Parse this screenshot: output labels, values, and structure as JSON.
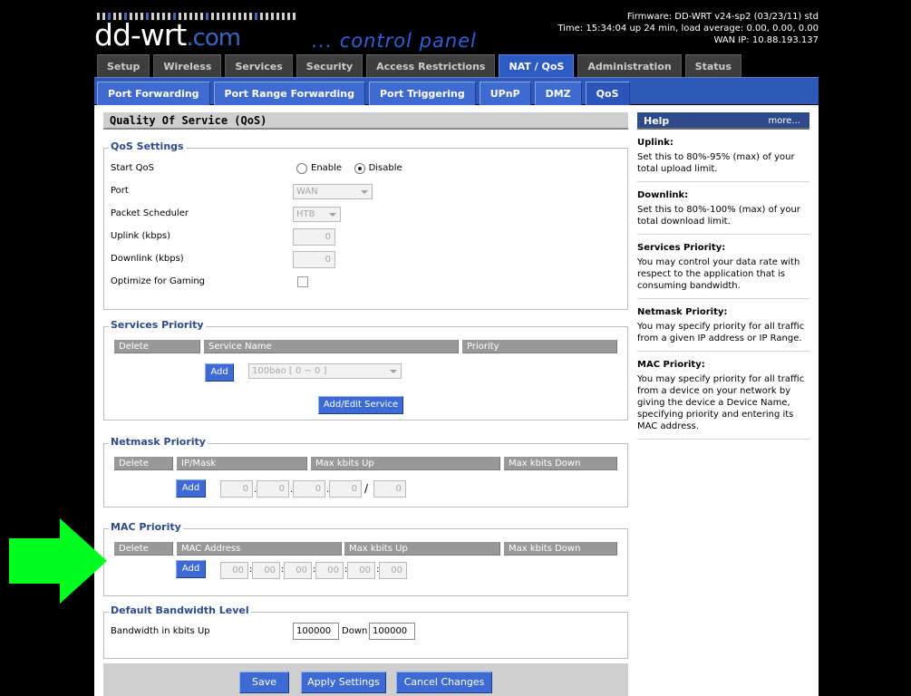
{
  "logo": {
    "main": "dd-wrt",
    "suffix": ".com",
    "tagline": "... control panel"
  },
  "firmware_info": {
    "firmware": "Firmware: DD-WRT v24-sp2 (03/23/11) std",
    "time": "Time: 15:34:04 up 24 min, load average: 0.00, 0.00, 0.00",
    "wan_ip": "WAN IP: 10.88.193.137"
  },
  "main_tabs": [
    {
      "label": "Setup"
    },
    {
      "label": "Wireless"
    },
    {
      "label": "Services"
    },
    {
      "label": "Security"
    },
    {
      "label": "Access Restrictions"
    },
    {
      "label": "NAT / QoS",
      "active": true
    },
    {
      "label": "Administration"
    },
    {
      "label": "Status"
    }
  ],
  "sub_tabs": [
    {
      "label": "Port Forwarding"
    },
    {
      "label": "Port Range Forwarding"
    },
    {
      "label": "Port Triggering"
    },
    {
      "label": "UPnP"
    },
    {
      "label": "DMZ"
    },
    {
      "label": "QoS",
      "active": true
    }
  ],
  "page_title": "Quality Of Service (QoS)",
  "qos_settings": {
    "legend": "QoS Settings",
    "start_qos_label": "Start QoS",
    "enable_label": "Enable",
    "disable_label": "Disable",
    "start_qos_value": "Disable",
    "port_label": "Port",
    "port_value": "WAN",
    "scheduler_label": "Packet Scheduler",
    "scheduler_value": "HTB",
    "uplink_label": "Uplink (kbps)",
    "uplink_value": "0",
    "downlink_label": "Downlink (kbps)",
    "downlink_value": "0",
    "gaming_label": "Optimize for Gaming"
  },
  "services_priority": {
    "legend": "Services Priority",
    "headers": [
      "Delete",
      "Service Name",
      "Priority"
    ],
    "add_label": "Add",
    "service_select": "100bao [ 0 ~ 0 ]",
    "add_edit_label": "Add/Edit Service"
  },
  "netmask_priority": {
    "legend": "Netmask Priority",
    "headers": [
      "Delete",
      "IP/Mask",
      "Max kbits Up",
      "Max kbits Down"
    ],
    "add_label": "Add",
    "ip_octets": [
      "0",
      "0",
      "0",
      "0"
    ],
    "mask": "0"
  },
  "mac_priority": {
    "legend": "MAC Priority",
    "headers": [
      "Delete",
      "MAC Address",
      "Max kbits Up",
      "Max kbits Down"
    ],
    "add_label": "Add",
    "mac_octets": [
      "00",
      "00",
      "00",
      "00",
      "00",
      "00"
    ]
  },
  "default_bandwidth": {
    "legend": "Default Bandwidth Level",
    "label": "Bandwidth in kbits Up",
    "up_value": "100000",
    "down_label": "Down",
    "down_value": "100000"
  },
  "actions": {
    "save": "Save",
    "apply": "Apply Settings",
    "cancel": "Cancel Changes"
  },
  "help": {
    "title": "Help",
    "more": "more...",
    "items": [
      {
        "title": "Uplink:",
        "text": "Set this to 80%-95% (max) of your total upload limit."
      },
      {
        "title": "Downlink:",
        "text": "Set this to 80%-100% (max) of your total download limit."
      },
      {
        "title": "Services Priority:",
        "text": "You may control your data rate with respect to the application that is consuming bandwidth."
      },
      {
        "title": "Netmask Priority:",
        "text": "You may specify priority for all traffic from a given IP address or IP Range."
      },
      {
        "title": "MAC Priority:",
        "text": "You may specify priority for all traffic from a device on your network by giving the device a Device Name, specifying priority and entering its MAC address."
      }
    ]
  },
  "colors": {
    "accent": "#2f59b8",
    "arrow": "#00ff1e"
  }
}
